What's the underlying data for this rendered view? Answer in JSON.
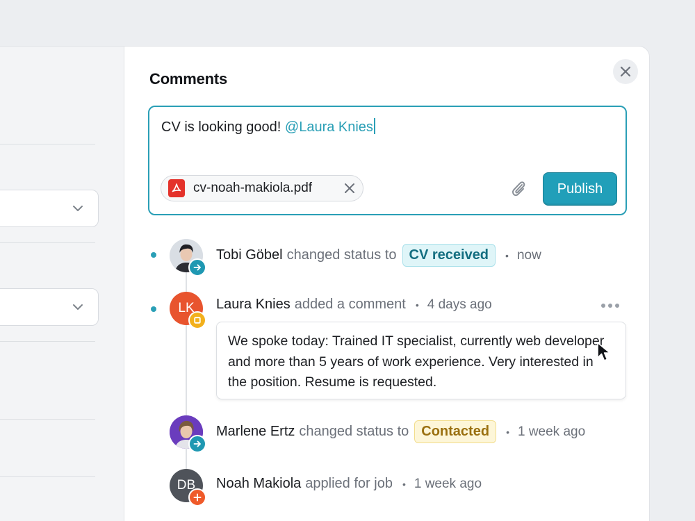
{
  "panel": {
    "title": "Comments",
    "close_icon": "close-icon"
  },
  "composer": {
    "text": "CV is looking good! ",
    "mention": "@Laura Knies",
    "attachment": {
      "file_name": "cv-noah-makiola.pdf",
      "icon": "pdf-file-icon"
    },
    "publish_label": "Publish",
    "accent_color": "#2a9fb6"
  },
  "timeline": [
    {
      "name": "Tobi Göbel",
      "action": "changed status to",
      "status": "CV received",
      "time": "now",
      "unread": true,
      "badge_icon": "arrow-right-icon"
    },
    {
      "name": "Laura Knies",
      "initials": "LK",
      "action": "added a comment",
      "time": "4 days ago",
      "unread": true,
      "badge_icon": "comment-icon",
      "comment": "We spoke today: Trained IT specialist, currently web developer and more than 5 years of work experience. Very interested in the position. Resume is requested."
    },
    {
      "name": "Marlene Ertz",
      "action": "changed status to",
      "status": "Contacted",
      "time": "1 week ago",
      "unread": false,
      "badge_icon": "arrow-right-icon"
    },
    {
      "name": "Noah Makiola",
      "initials": "DB",
      "action": "applied for job",
      "time": "1 week ago",
      "unread": false,
      "badge_icon": "plus-icon"
    }
  ],
  "separator": "•"
}
